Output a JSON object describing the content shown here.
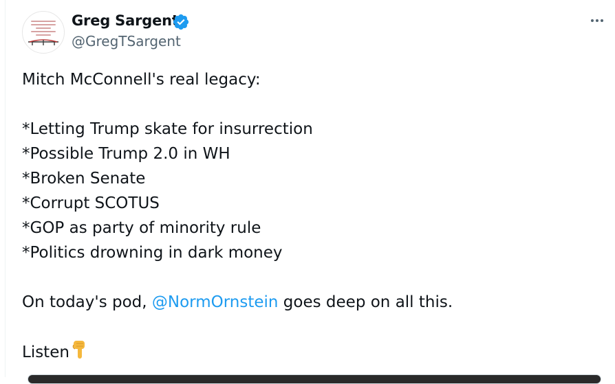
{
  "author": {
    "name": "Greg Sargent",
    "handle": "@GregTSargent",
    "verified": true,
    "avatar_icon": "book-cover-avatar"
  },
  "actions": {
    "more_icon": "more-options-icon"
  },
  "tweet": {
    "intro": "Mitch McConnell's real legacy:",
    "bullets": [
      "*Letting Trump skate for insurrection",
      "*Possible Trump 2.0 in WH",
      "*Broken Senate",
      "*Corrupt SCOTUS",
      "*GOP as party of minority rule",
      "*Politics drowning in dark money"
    ],
    "pod_prefix": "On today's pod, ",
    "mention": "@NormOrnstein",
    "pod_suffix": " goes deep on all this.",
    "listen": "Listen",
    "listen_emoji": "pointing-down-icon"
  },
  "colors": {
    "accent": "#1d9bf0",
    "text": "#0f1419",
    "secondary": "#536471"
  }
}
